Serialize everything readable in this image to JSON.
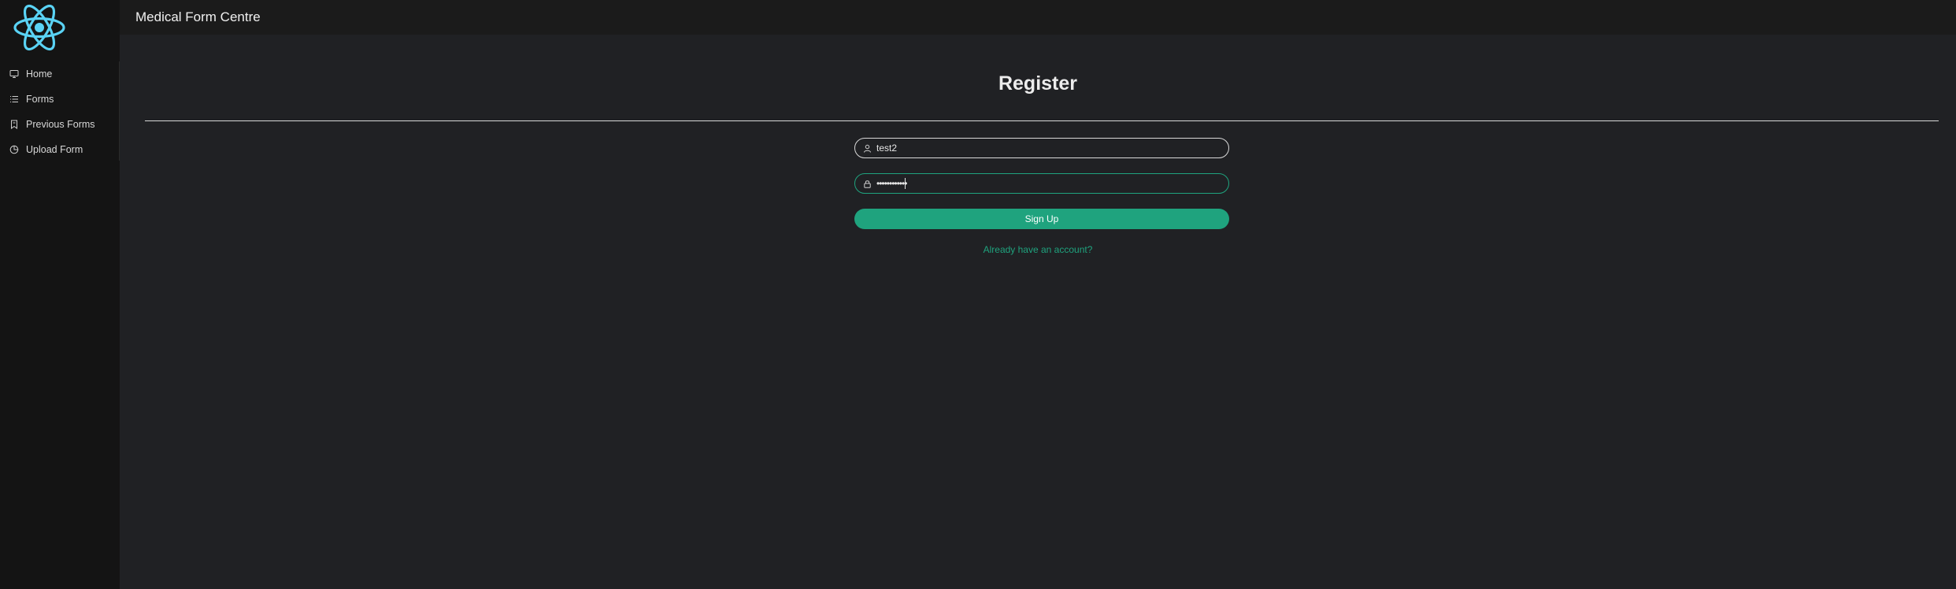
{
  "app": {
    "title": "Medical Form Centre",
    "logo_icon": "react-atom-icon",
    "accent_color": "#1fa37e",
    "logo_color": "#5ad3f5"
  },
  "sidebar": {
    "items": [
      {
        "label": "Home",
        "icon": "monitor-icon"
      },
      {
        "label": "Forms",
        "icon": "list-icon"
      },
      {
        "label": "Previous Forms",
        "icon": "bookmark-icon"
      },
      {
        "label": "Upload Form",
        "icon": "pie-chart-icon"
      }
    ]
  },
  "register": {
    "title": "Register",
    "username": {
      "value": "test2",
      "icon": "user-icon"
    },
    "password": {
      "value": "••••••••••••",
      "icon": "lock-icon"
    },
    "signup_label": "Sign Up",
    "login_link": "Already have an account?"
  }
}
